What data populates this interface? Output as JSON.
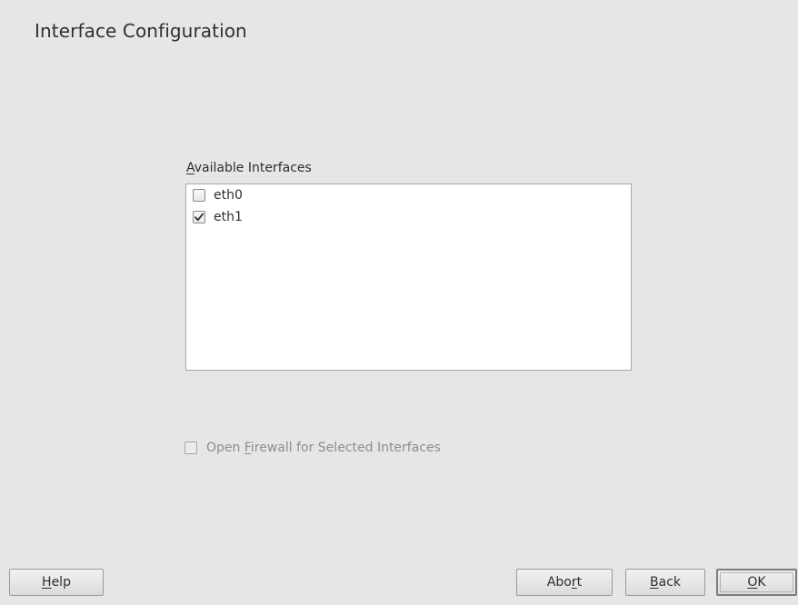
{
  "header": {
    "title": "Interface Configuration"
  },
  "interfaces": {
    "label_mnemonic": "A",
    "label_rest": "vailable Interfaces",
    "items": [
      {
        "label": "eth0",
        "checked": false
      },
      {
        "label": "eth1",
        "checked": true
      }
    ]
  },
  "firewall": {
    "label_pre": "Open ",
    "label_mnemonic": "F",
    "label_post": "irewall for Selected Interfaces",
    "checked": false,
    "enabled": false
  },
  "buttons": {
    "help": {
      "mnemonic": "H",
      "rest": "elp"
    },
    "abort": {
      "pre": "Abo",
      "mnemonic": "r",
      "post": "t"
    },
    "back": {
      "mnemonic": "B",
      "rest": "ack"
    },
    "ok": {
      "mnemonic": "O",
      "rest": "K"
    }
  },
  "icons": {
    "checkbox_checked": "check-mark-icon",
    "checkbox_unchecked": "empty-checkbox-icon"
  }
}
